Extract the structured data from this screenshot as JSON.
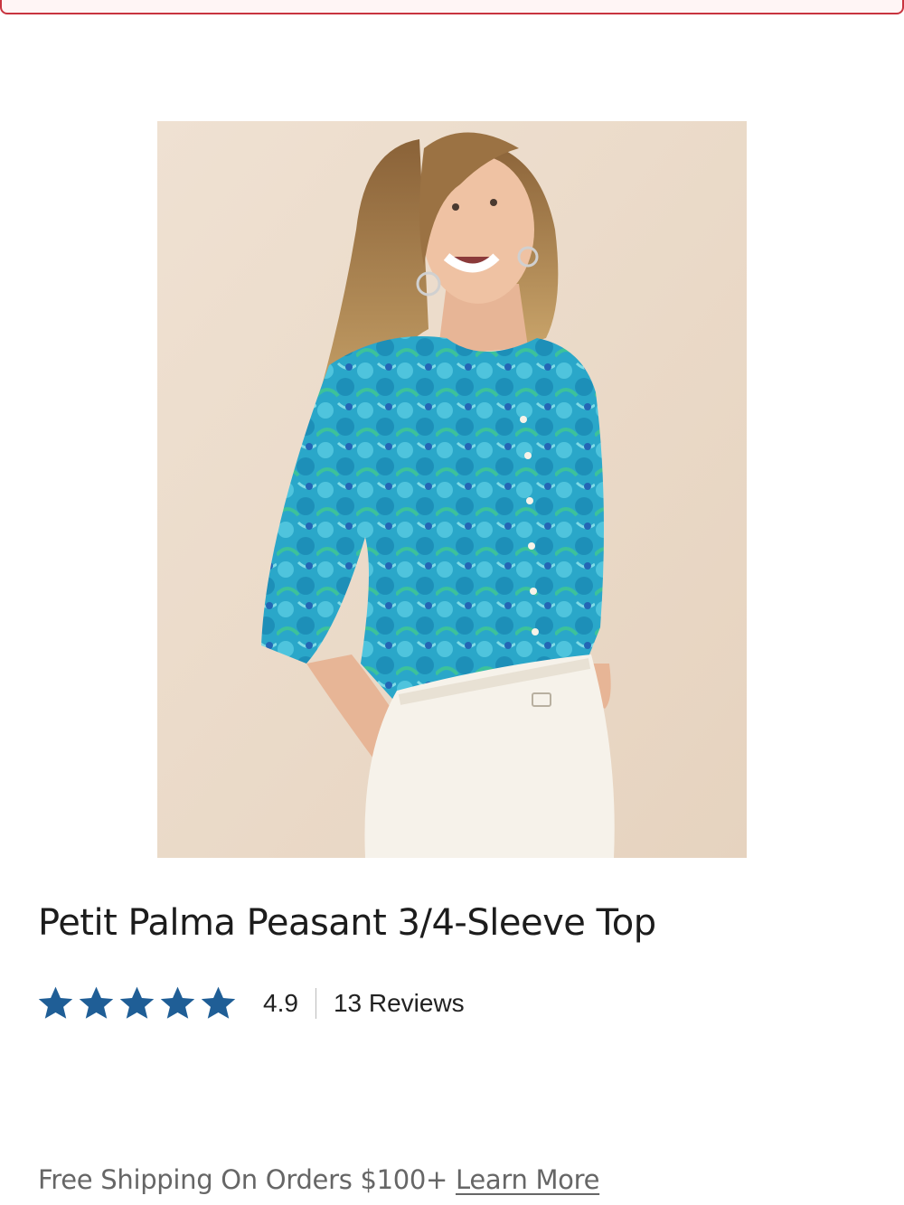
{
  "product": {
    "title": "Petit Palma Peasant 3/4-Sleeve Top",
    "image_alt": "Model wearing turquoise floral peasant top with white pants",
    "rating": {
      "value": "4.9",
      "stars": 5,
      "reviews_label": "13 Reviews"
    }
  },
  "shipping_banner": {
    "text": "Free Shipping On Orders $100+",
    "link_label": "Learn More"
  },
  "colors": {
    "star": "#1f5e96",
    "alert_border": "#c8343f",
    "top_turquoise": "#2aa7c9"
  }
}
